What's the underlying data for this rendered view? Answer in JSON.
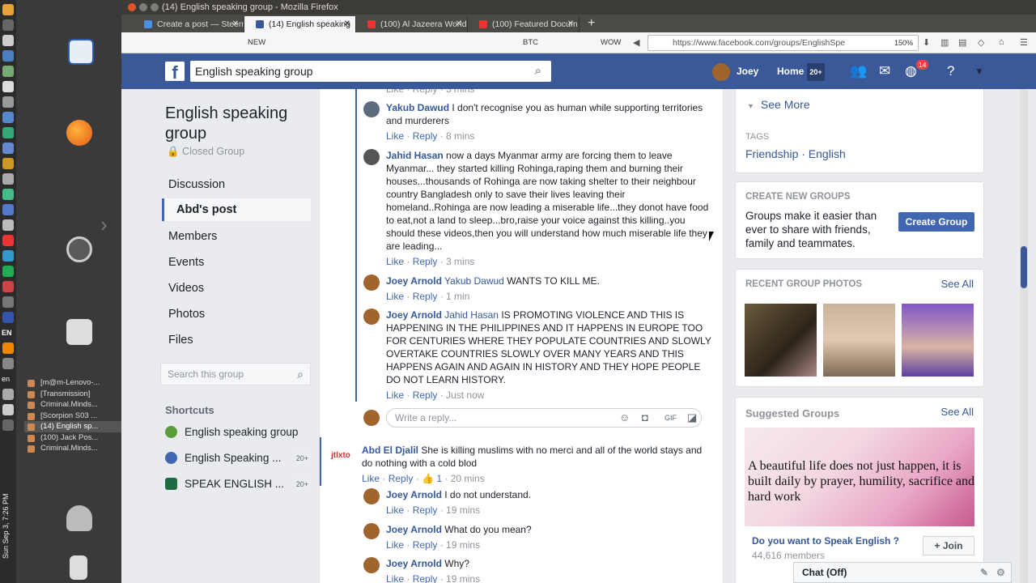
{
  "window": {
    "title": "(14) English speaking group - Mozilla Firefox"
  },
  "tabs": [
    {
      "label": "Create a post — Steem"
    },
    {
      "label": "(14) English speaking"
    },
    {
      "label": "(100) Al Jazeera World"
    },
    {
      "label": "(100) Featured Docum"
    }
  ],
  "bookmarks": [
    "NEW",
    "BTC",
    "WOW"
  ],
  "url": "https://www.facebook.com/groups/EnglishSpe",
  "zoom": "150%",
  "taskbar": {
    "items": [
      "[m@m-Lenovo-...",
      "[Transmission]",
      "Criminal.Minds...",
      "[Scorpion S03 ...",
      "(14) English sp...",
      "(100) Jack Pos...",
      "Criminal.Minds..."
    ],
    "lang": "EN",
    "lang2": "en",
    "clock": "Sun Sep 3, 7:26 PM"
  },
  "fb": {
    "search_value": "English speaking group",
    "user": "Joey",
    "home": "Home",
    "home_badge": "20+",
    "notifications": "14"
  },
  "group": {
    "title": "English speaking group",
    "privacy": "Closed Group",
    "nav": [
      "Discussion",
      "Abd's post",
      "Members",
      "Events",
      "Videos",
      "Photos",
      "Files"
    ],
    "search_placeholder": "Search this group",
    "shortcuts_label": "Shortcuts",
    "shortcuts": [
      {
        "label": "English speaking group",
        "count": ""
      },
      {
        "label": "English Speaking ...",
        "count": "20+"
      },
      {
        "label": "SPEAK ENGLISH ...",
        "count": "20+"
      }
    ]
  },
  "feed": {
    "top_partial": "Like · Reply · 3 mins",
    "comments": [
      {
        "name": "Yakub Dawud",
        "ref": "",
        "text": "I don't recognise you as human while supporting territories and murderers",
        "like": "Like",
        "reply": "Reply",
        "time": "8 mins"
      },
      {
        "name": "Jahid Hasan",
        "ref": "",
        "text": "now a days Myanmar army are forcing them to leave Myanmar... they started killing Rohinga,raping them and burning their houses...thousands of Rohinga are now taking shelter to their neighbour country Bangladesh only to save their lives leaving their homeland..Rohinga are now leading a miserable life...they donot have food to eat,not a land to sleep...bro,raise your voice against this killing..you should these videos,then you will understand how much miserable life they are leading...",
        "like": "Like",
        "reply": "Reply",
        "time": "3 mins"
      },
      {
        "name": "Joey Arnold",
        "ref": "Yakub Dawud",
        "text": "WANTS TO KILL ME.",
        "like": "Like",
        "reply": "Reply",
        "time": "1 min"
      },
      {
        "name": "Joey Arnold",
        "ref": "Jahid Hasan",
        "text": "IS PROMOTING VIOLENCE AND THIS IS HAPPENING IN THE PHILIPPINES AND IT HAPPENS IN EUROPE TOO FOR CENTURIES WHERE THEY POPULATE COUNTRIES AND SLOWLY OVERTAKE COUNTRIES SLOWLY OVER MANY YEARS AND THIS HAPPENS AGAIN AND AGAIN IN HISTORY AND THEY HOPE PEOPLE DO NOT LEARN HISTORY.",
        "like": "Like",
        "reply": "Reply",
        "time": "Just now"
      }
    ],
    "reply_placeholder": "Write a reply...",
    "post2": {
      "avatar_text": "jtlxto",
      "name": "Abd El Djalil",
      "text": "She is killing muslims with no merci and all of the world stays and do nothing with a cold blod",
      "like": "Like",
      "reply": "Reply",
      "likes": "1",
      "time": "20 mins"
    },
    "replies2": [
      {
        "name": "Joey Arnold",
        "text": "I do not understand.",
        "like": "Like",
        "reply": "Reply",
        "time": "19 mins"
      },
      {
        "name": "Joey Arnold",
        "text": "What do you mean?",
        "like": "Like",
        "reply": "Reply",
        "time": "19 mins"
      },
      {
        "name": "Joey Arnold",
        "text": "Why?",
        "like": "Like",
        "reply": "Reply",
        "time": "19 mins"
      }
    ]
  },
  "right": {
    "see_more": "See More",
    "tags_label": "TAGS",
    "tags": "Friendship · English",
    "create_label": "CREATE NEW GROUPS",
    "create_text": "Groups make it easier than ever to share with friends, family and teammates.",
    "create_button": "Create Group",
    "photos_label": "RECENT GROUP PHOTOS",
    "see_all": "See All",
    "suggested_label": "Suggested Groups",
    "suggested_see_all": "See All",
    "sg_quote": "A beautiful life does not just happen, it is built daily by prayer, humility, sacrifice and hard work",
    "sg_title": "Do you want to Speak English ?",
    "sg_members": "44,616 members",
    "join": "Join"
  },
  "chat": {
    "label": "Chat (Off)"
  }
}
